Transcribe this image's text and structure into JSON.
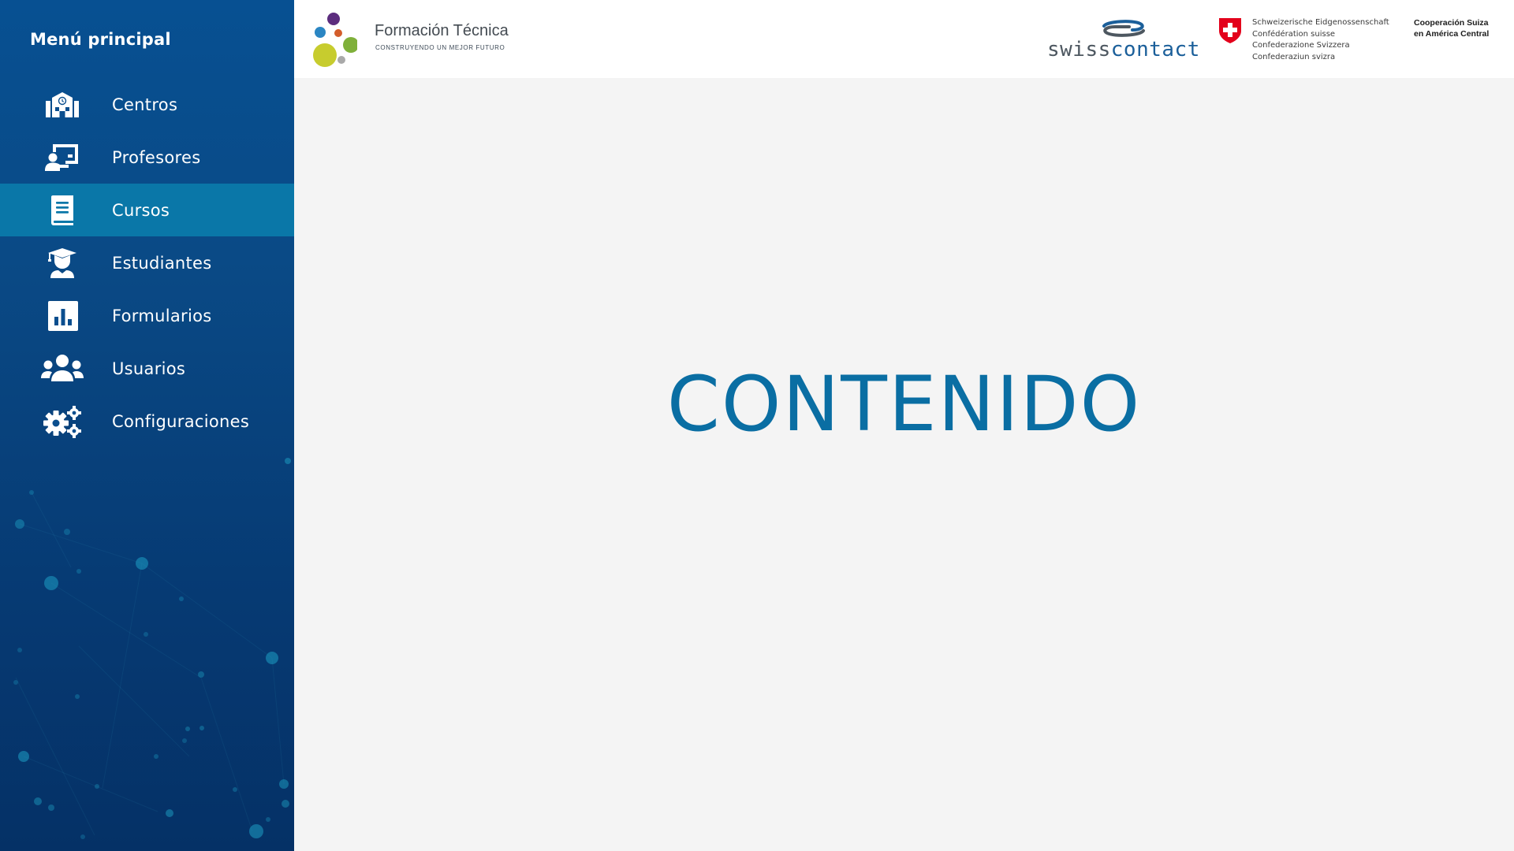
{
  "sidebar": {
    "title": "Menú principal",
    "items": [
      {
        "label": "Centros",
        "icon": "school-building-icon"
      },
      {
        "label": "Profesores",
        "icon": "teacher-board-icon"
      },
      {
        "label": "Cursos",
        "icon": "book-icon",
        "active": true
      },
      {
        "label": "Estudiantes",
        "icon": "graduate-student-icon"
      },
      {
        "label": "Formularios",
        "icon": "bar-chart-form-icon"
      },
      {
        "label": "Usuarios",
        "icon": "users-group-icon"
      },
      {
        "label": "Configuraciones",
        "icon": "gears-icon"
      }
    ]
  },
  "header": {
    "brand_title": "Formación Técnica",
    "brand_subtitle": "CONSTRUYENDO UN MEJOR FUTURO",
    "partner_swiss": "swiss",
    "partner_contact": "contact",
    "confederation": [
      "Schweizerische Eidgenossenschaft",
      "Confédération suisse",
      "Confederazione Svizzera",
      "Confederaziun svizra"
    ],
    "cooperation": [
      "Cooperación Suiza",
      "en América Central"
    ]
  },
  "main": {
    "title": "CONTENIDO"
  },
  "colors": {
    "sidebar_top": "#075092",
    "sidebar_bottom": "#053166",
    "active_item": "#0a77a8",
    "content_bg": "#f4f4f4",
    "content_title": "#0a6ea3",
    "swiss_red": "#e3001b"
  }
}
